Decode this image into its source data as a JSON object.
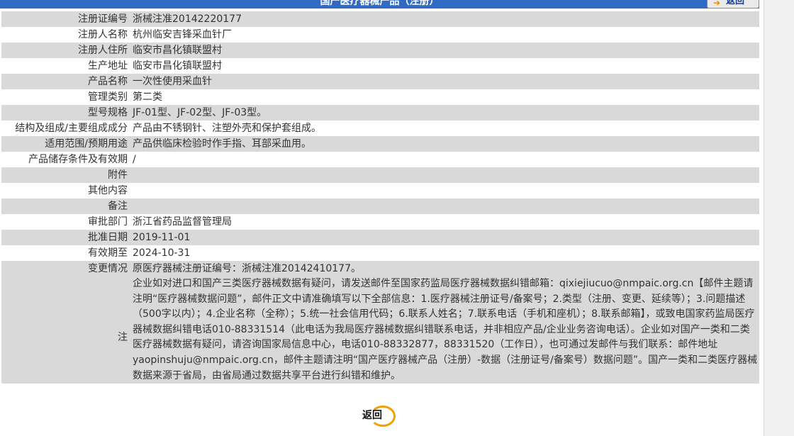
{
  "header": {
    "title": "国产医疗器械产品（注册）",
    "back_label": "返回"
  },
  "rows": [
    {
      "label": "注册证编号",
      "value": "浙械注准20142220177"
    },
    {
      "label": "注册人名称",
      "value": "杭州临安吉锋采血针厂"
    },
    {
      "label": "注册人住所",
      "value": "临安市昌化镇联盟村"
    },
    {
      "label": "生产地址",
      "value": "临安市昌化镇联盟村"
    },
    {
      "label": "产品名称",
      "value": "一次性使用采血针"
    },
    {
      "label": "管理类别",
      "value": "第二类"
    },
    {
      "label": "型号规格",
      "value": "JF-01型、JF-02型、JF-03型。"
    },
    {
      "label": "结构及组成/主要组成成分",
      "value": "产品由不锈钢针、注塑外壳和保护套组成。"
    },
    {
      "label": "适用范围/预期用途",
      "value": "产品供临床检验时作手指、耳部采血用。"
    },
    {
      "label": "产品储存条件及有效期",
      "value": "/"
    },
    {
      "label": "附件",
      "value": ""
    },
    {
      "label": "其他内容",
      "value": ""
    },
    {
      "label": "备注",
      "value": ""
    },
    {
      "label": "审批部门",
      "value": "浙江省药品监督管理局"
    },
    {
      "label": "批准日期",
      "value": "2019-11-01"
    },
    {
      "label": "有效期至",
      "value": "2024-10-31"
    },
    {
      "label": "变更情况",
      "value": "原医疗器械注册证编号：浙械注准20142410177。"
    }
  ],
  "note": {
    "label": "注",
    "text": "企业如对进口和国产三类医疗器械数据有疑问，请发送邮件至国家药监局医疗器械数据纠错邮箱：qixiejiucuo@nmpaic.org.cn【邮件主题请注明“医疗器械数据问题”，邮件正文中请准确填写以下全部信息：1.医疗器械注册证号/备案号；2.类型（注册、变更、延续等）；3.问题描述（500字以内）；4.企业名称（全称）；5.统一社会信用代码；6.联系人姓名；7.联系电话（手机和座机）；8.联系邮箱】，或致电国家药监局医疗器械数据纠错电话010-88331514（此电话为我局医疗器械数据纠错联系电话，并非相应产品/企业业务咨询电话）。企业如对国产一类和二类医疗器械数据有疑问，请咨询国家局信息中心，电话010-88332877，88331520（工作日），也可通过发邮件与我们联系：邮件地址yaopinshuju@nmpaic.org.cn，邮件主题请注明“国产医疗器械产品（注册）-数据（注册证号/备案号）数据问题”。国产一类和二类医疗器械数据来源于省局，由省局通过数据共享平台进行纠错和维护。"
  },
  "footer": {
    "back_label": "返回"
  }
}
